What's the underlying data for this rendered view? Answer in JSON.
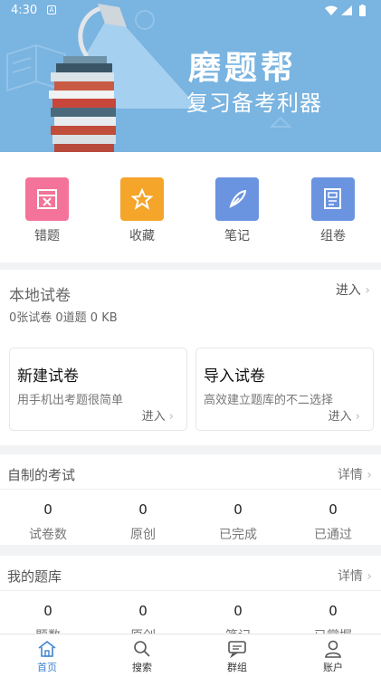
{
  "status_bar": {
    "time": "4:30",
    "icons": [
      "a-notification-icon",
      "wifi-icon",
      "signal-icon",
      "battery-icon"
    ]
  },
  "banner": {
    "title": "磨题帮",
    "subtitle": "复习备考利器"
  },
  "quick_actions": [
    {
      "label": "错题",
      "icon": "wrong-question-icon",
      "color": "#f4739a"
    },
    {
      "label": "收藏",
      "icon": "star-icon",
      "color": "#f4a52a"
    },
    {
      "label": "笔记",
      "icon": "feather-icon",
      "color": "#6b94e0"
    },
    {
      "label": "组卷",
      "icon": "paper-icon",
      "color": "#6b94e0"
    }
  ],
  "local": {
    "title": "本地试卷",
    "enter": "进入",
    "stats": "0张试卷 0道题 0 KB",
    "new_paper": {
      "title": "新建试卷",
      "desc": "用手机出考题很简单",
      "enter": "进入"
    },
    "import_paper": {
      "title": "导入试卷",
      "desc": "高效建立题库的不二选择",
      "enter": "进入"
    }
  },
  "exams": {
    "title": "自制的考试",
    "more": "详情",
    "cells": [
      {
        "value": "0",
        "label": "试卷数"
      },
      {
        "value": "0",
        "label": "原创"
      },
      {
        "value": "0",
        "label": "已完成"
      },
      {
        "value": "0",
        "label": "已通过"
      }
    ]
  },
  "bank": {
    "title": "我的题库",
    "more": "详情",
    "cells": [
      {
        "value": "0",
        "label": "题数"
      },
      {
        "value": "0",
        "label": "原创"
      },
      {
        "value": "0",
        "label": "笔记"
      },
      {
        "value": "0",
        "label": "已掌握"
      }
    ]
  },
  "nav": [
    {
      "label": "首页",
      "icon": "home-icon",
      "active": true
    },
    {
      "label": "搜索",
      "icon": "search-icon",
      "active": false
    },
    {
      "label": "群组",
      "icon": "chat-icon",
      "active": false
    },
    {
      "label": "账户",
      "icon": "user-icon",
      "active": false
    }
  ],
  "colors": {
    "banner": "#7ab4e0",
    "accent": "#3f83cf"
  }
}
